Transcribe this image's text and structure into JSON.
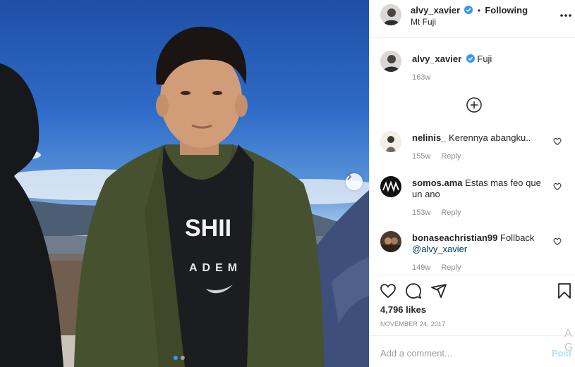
{
  "post": {
    "author": "alvy_xavier",
    "following_label": "Following",
    "separator": "•",
    "location": "Mt Fuji",
    "caption": "Fuji",
    "caption_age": "163w",
    "carousel": {
      "total_slides": 2,
      "active_slide": 1
    }
  },
  "comments": [
    {
      "user": "nelinis_",
      "text": "Kerennya abangku..",
      "age": "155w",
      "reply_label": "Reply"
    },
    {
      "user": "somos.ama",
      "text": "Estas mas feo que un ano",
      "age": "153w",
      "reply_label": "Reply"
    },
    {
      "user": "bonaseachristian99",
      "text": "Follback",
      "mention": "@alvy_xavier",
      "age": "149w",
      "reply_label": "Reply"
    }
  ],
  "stats": {
    "likes": "4,796 likes",
    "date": "NOVEMBER 24, 2017"
  },
  "composer": {
    "placeholder": "Add a comment...",
    "post_label": "Post"
  },
  "watermark": {
    "line1": "A",
    "line2": "G"
  },
  "icons": {
    "verified": "verified-badge-icon",
    "more": "more-options-icon",
    "load_more": "plus-circle-icon",
    "heart": "heart-icon",
    "comment": "comment-icon",
    "share": "share-icon",
    "save": "bookmark-icon",
    "next": "chevron-right-icon"
  },
  "colors": {
    "verified": "#3897f0",
    "link": "#00376b",
    "muted": "#8e8e8e",
    "post_disabled": "#b2dffc"
  }
}
